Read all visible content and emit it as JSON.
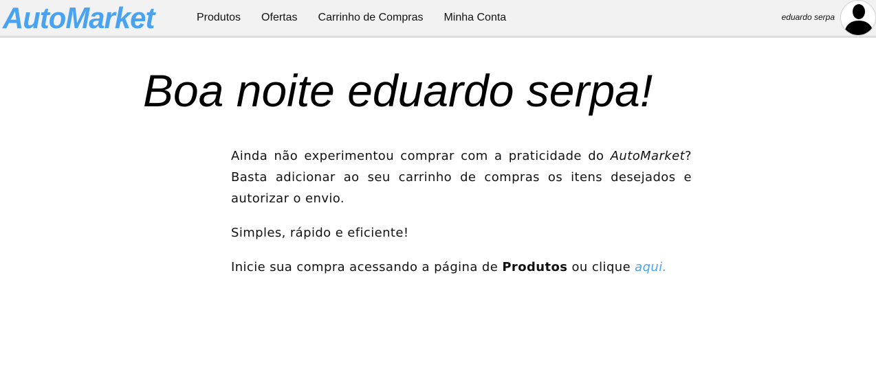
{
  "header": {
    "brand": "AutoMarket",
    "nav": [
      {
        "label": "Produtos"
      },
      {
        "label": "Ofertas"
      },
      {
        "label": "Carrinho de Compras"
      },
      {
        "label": "Minha Conta"
      }
    ],
    "user_name": "eduardo serpa",
    "avatar_icon": "user-silhouette-icon"
  },
  "main": {
    "greeting": "Boa noite eduardo serpa!",
    "p1_text_a": "Ainda não experimentou comprar com a praticidade do ",
    "p1_brand": "AutoMarket",
    "p1_text_b": "? Basta adicionar ao seu carrinho de compras os itens desejados e autorizar o envio.",
    "p2": "Simples, rápido e eficiente!",
    "p3_text_a": "Inicie sua compra acessando a página de ",
    "p3_bold": "Produtos",
    "p3_text_b": " ou clique ",
    "p3_link": "aqui."
  },
  "colors": {
    "accent": "#4aa3f0",
    "header_bg": "#f2f2f2"
  }
}
